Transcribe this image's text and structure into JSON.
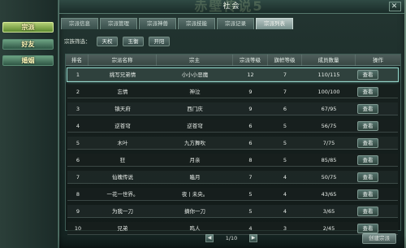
{
  "window": {
    "title": "社会",
    "watermark": "赤壁传说5"
  },
  "sidebar": {
    "items": [
      {
        "label": "宗派"
      },
      {
        "label": "好友"
      },
      {
        "label": "婚姻"
      }
    ]
  },
  "tabs": [
    {
      "label": "宗派信息"
    },
    {
      "label": "宗派管理"
    },
    {
      "label": "宗派神兽"
    },
    {
      "label": "宗派技能"
    },
    {
      "label": "宗派记录"
    },
    {
      "label": "宗派列表"
    }
  ],
  "filters": {
    "label": "宗族筛选：",
    "options": [
      "天权",
      "玉衡",
      "开阳"
    ]
  },
  "table": {
    "headers": [
      "排名",
      "宗派名称",
      "宗主",
      "宗派等级",
      "旗帜等级",
      "成员数量",
      "操作"
    ],
    "rows": [
      {
        "rank": "1",
        "name": "挑写兄弟情",
        "leader": "小小小恶魔",
        "clan_level": "12",
        "banner_level": "7",
        "members": "110/115",
        "action": "查看"
      },
      {
        "rank": "2",
        "name": "忘情",
        "leader": "神泣",
        "clan_level": "9",
        "banner_level": "7",
        "members": "100/100",
        "action": "查看"
      },
      {
        "rank": "3",
        "name": "镇天府",
        "leader": "西门庆",
        "clan_level": "9",
        "banner_level": "6",
        "members": "67/95",
        "action": "查看"
      },
      {
        "rank": "4",
        "name": "逆苍穹",
        "leader": "逆苍穹",
        "clan_level": "6",
        "banner_level": "5",
        "members": "56/75",
        "action": "查看"
      },
      {
        "rank": "5",
        "name": "木叶",
        "leader": "九方舞吹",
        "clan_level": "6",
        "banner_level": "5",
        "members": "7/75",
        "action": "查看"
      },
      {
        "rank": "6",
        "name": "狂",
        "leader": "月亲",
        "clan_level": "8",
        "banner_level": "5",
        "members": "85/85",
        "action": "查看"
      },
      {
        "rank": "7",
        "name": "仙魄传说",
        "leader": "瞌月",
        "clan_level": "7",
        "banner_level": "4",
        "members": "50/75",
        "action": "查看"
      },
      {
        "rank": "8",
        "name": "一花一世界。",
        "leader": "夜丨未央。",
        "clan_level": "5",
        "banner_level": "4",
        "members": "43/65",
        "action": "查看"
      },
      {
        "rank": "9",
        "name": "为我一刀",
        "leader": "摘你一刀",
        "clan_level": "5",
        "banner_level": "4",
        "members": "3/65",
        "action": "查看"
      },
      {
        "rank": "10",
        "name": "兄弟",
        "leader": "鸣人",
        "clan_level": "4",
        "banner_level": "3",
        "members": "2/45",
        "action": "查看"
      }
    ]
  },
  "pagination": {
    "prev": "◀",
    "text": "1/10",
    "next": "▶"
  },
  "footer": {
    "create_label": "创建宗派"
  },
  "colors": {
    "accent": "#9fd7cc",
    "active_tab": "#b7c6c4",
    "active_side": "#8fbf4a"
  }
}
